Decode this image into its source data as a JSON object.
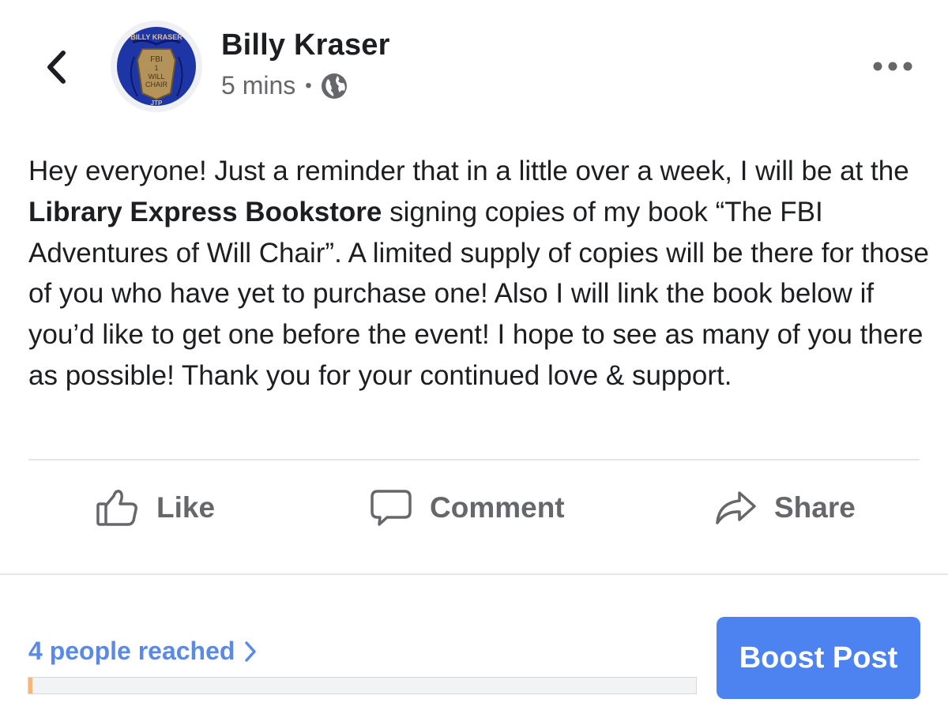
{
  "header": {
    "author_name": "Billy Kraser",
    "timestamp": "5 mins",
    "separator": "•",
    "audience_icon": "globe-icon",
    "back_icon": "chevron-left-icon",
    "more_icon": "more-dots-icon"
  },
  "avatar": {
    "badge_top": "BILLY KRASER",
    "badge_line1": "FBI",
    "badge_line2": "1",
    "badge_line3": "WILL",
    "badge_line4": "CHAIR",
    "badge_bottom": "JTP"
  },
  "post": {
    "text_before": "Hey everyone! Just a reminder that in a little over a week, I will be at the ",
    "text_bold": "Library Express Bookstore",
    "text_after": " signing copies of my book “The FBI Adventures of Will Chair”. A limited supply of copies will be there for those of you who have yet to purchase one! Also I will link the book below if you’d like to get one before the event! I hope to see as many of you there as possible! Thank you for your continued love & support."
  },
  "actions": {
    "like_label": "Like",
    "comment_label": "Comment",
    "share_label": "Share"
  },
  "insights": {
    "reach_label": "4 people reached",
    "reach_progress_fraction": 0.006,
    "boost_label": "Boost Post"
  },
  "colors": {
    "boost_button": "#4c83f0",
    "reach_link": "#5b89e6",
    "reach_fill": "#f4b67a",
    "action_gray": "#65676b"
  }
}
